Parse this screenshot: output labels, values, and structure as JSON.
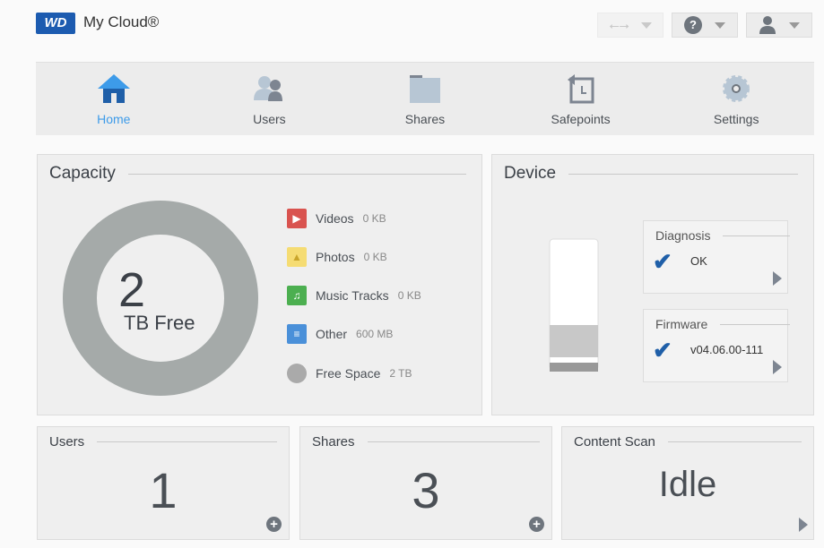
{
  "header": {
    "logo": "WD",
    "brand": "My Cloud®"
  },
  "nav": [
    {
      "label": "Home",
      "active": true
    },
    {
      "label": "Users"
    },
    {
      "label": "Shares"
    },
    {
      "label": "Safepoints"
    },
    {
      "label": "Settings"
    }
  ],
  "capacity": {
    "title": "Capacity",
    "free_value": "2",
    "free_unit": "TB Free",
    "legend": [
      {
        "label": "Videos",
        "size": "0 KB",
        "color": "#d9534f"
      },
      {
        "label": "Photos",
        "size": "0 KB",
        "color": "#f0d264"
      },
      {
        "label": "Music Tracks",
        "size": "0 KB",
        "color": "#4caf50"
      },
      {
        "label": "Other",
        "size": "600 MB",
        "color": "#4a90d9"
      },
      {
        "label": "Free Space",
        "size": "2 TB",
        "color": "#aaaaaa"
      }
    ]
  },
  "device": {
    "title": "Device",
    "diagnosis": {
      "title": "Diagnosis",
      "value": "OK"
    },
    "firmware": {
      "title": "Firmware",
      "value": "v04.06.00-111"
    }
  },
  "cards": {
    "users": {
      "title": "Users",
      "value": "1"
    },
    "shares": {
      "title": "Shares",
      "value": "3"
    },
    "content_scan": {
      "title": "Content Scan",
      "value": "Idle"
    }
  }
}
